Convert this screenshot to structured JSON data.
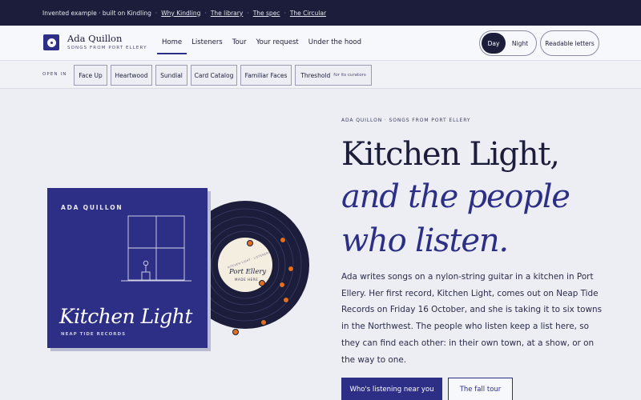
{
  "topbar": {
    "note": "Invented example · built on Kindling",
    "links": [
      "Why Kindling",
      "The library",
      "The spec",
      "The Circular"
    ]
  },
  "brand": {
    "name": "Ada Quillon",
    "subtitle": "SONGS FROM PORT ELLERY"
  },
  "nav": {
    "items": [
      "Home",
      "Listeners",
      "Tour",
      "Your request",
      "Under the hood"
    ],
    "active": "Home"
  },
  "theme": {
    "day": "Day",
    "night": "Night",
    "selected": "Day"
  },
  "readable_label": "Readable letters",
  "open_in": {
    "label": "OPEN IN",
    "chips": [
      "Face Up",
      "Heartwood",
      "Sundial",
      "Card Catalog",
      "Familiar Faces",
      "Threshold"
    ],
    "threshold_note": "for its curators"
  },
  "hero": {
    "eyebrow": "ADA QUILLON · SONGS FROM PORT ELLERY",
    "title_line1": "Kitchen Light,",
    "title_line2": "and the people",
    "title_line3": "who listen.",
    "lede": "Ada writes songs on a nylon-string guitar in a kitchen in Port Ellery. Her first record, Kitchen Light, comes out on Neap Tide Records on Friday 16 October, and she is taking it to six towns in the Northwest. The people who listen keep a list here, so they can find each other: in their own town, at a show, or on the way to one.",
    "cta_primary": "Who's listening near you",
    "cta_secondary": "The fall tour"
  },
  "album": {
    "artist": "ADA QUILLON",
    "title": "Kitchen Light",
    "label": "NEAP TIDE RECORDS",
    "record_label_title": "Port Ellery",
    "record_label_small": "MADE HERE",
    "record_label_arc": "KITCHEN LIGHT · LISTENERS",
    "colors": {
      "navy": "#2d2f86",
      "disc": "#1b1d3a",
      "dot": "#e0701f",
      "center": "#f4eee1"
    }
  }
}
